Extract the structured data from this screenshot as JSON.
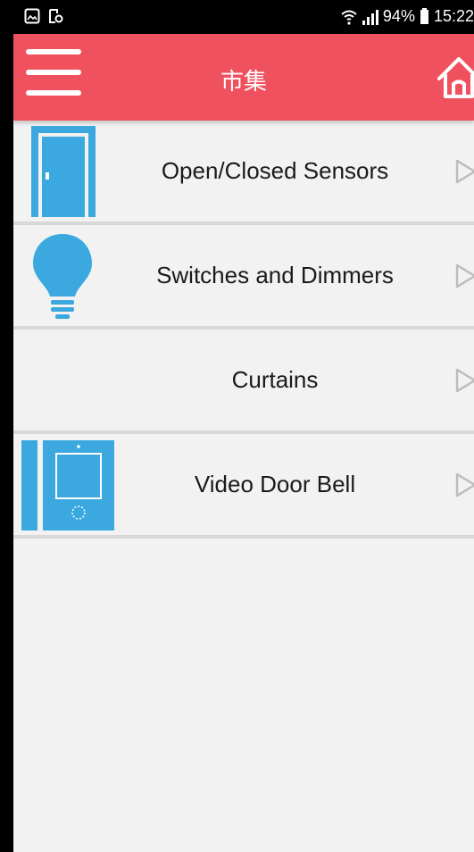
{
  "status_bar": {
    "battery_text": "94%",
    "time": "15:22",
    "left_icons": [
      "gallery-notification-icon",
      "screenshot-notification-icon"
    ],
    "right_icons": [
      "wifi-calling-icon",
      "signal-icon",
      "battery-icon"
    ]
  },
  "header": {
    "title": "市集",
    "menu_icon": "hamburger-menu-icon",
    "home_icon": "home-icon",
    "background_color": "#f0515f"
  },
  "list": {
    "items": [
      {
        "label": "Open/Closed Sensors",
        "icon": "door-icon"
      },
      {
        "label": "Switches and Dimmers",
        "icon": "light-bulb-icon"
      },
      {
        "label": "Curtains",
        "icon": ""
      },
      {
        "label": "Video Door Bell",
        "icon": "video-intercom-icon"
      }
    ],
    "arrow_icon": "chevron-right-outline-icon",
    "icon_color": "#3ba9e0",
    "divider_color": "#d8d8d8"
  }
}
